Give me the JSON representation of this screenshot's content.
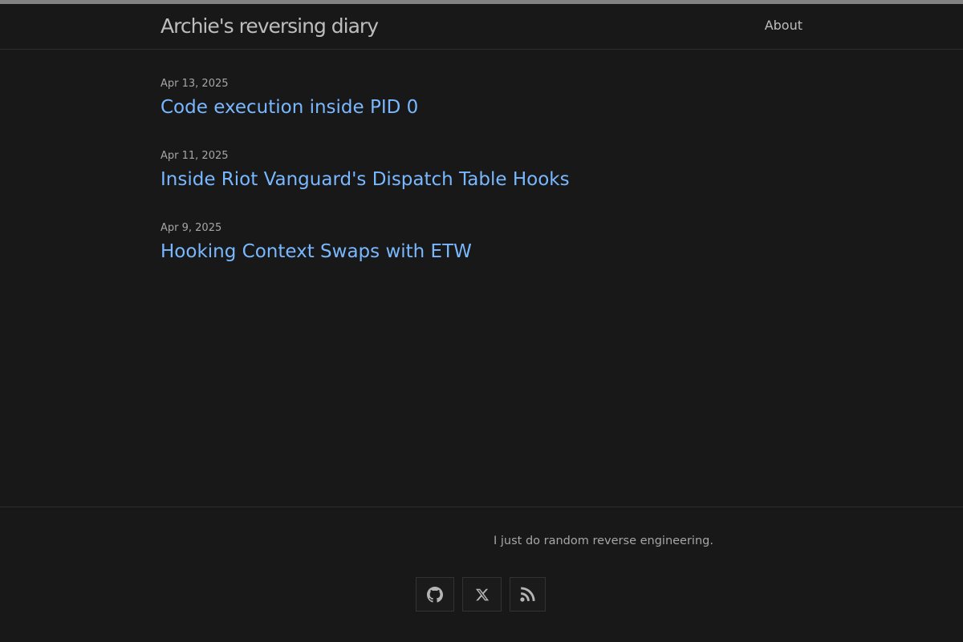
{
  "header": {
    "site_title": "Archie's reversing diary",
    "nav": [
      {
        "label": "About"
      }
    ]
  },
  "posts": [
    {
      "date": "Apr 13, 2025",
      "title": "Code execution inside PID 0"
    },
    {
      "date": "Apr 11, 2025",
      "title": "Inside Riot Vanguard's Dispatch Table Hooks"
    },
    {
      "date": "Apr 9, 2025",
      "title": "Hooking Context Swaps with ETW"
    }
  ],
  "footer": {
    "description": "I just do random reverse engineering.",
    "social": [
      {
        "icon": "github-icon"
      },
      {
        "icon": "x-icon"
      },
      {
        "icon": "rss-icon"
      }
    ]
  },
  "colors": {
    "background": "#181818",
    "link": "#79b8ff",
    "text_muted": "#a6a6a6",
    "title": "#bdbdbd"
  }
}
